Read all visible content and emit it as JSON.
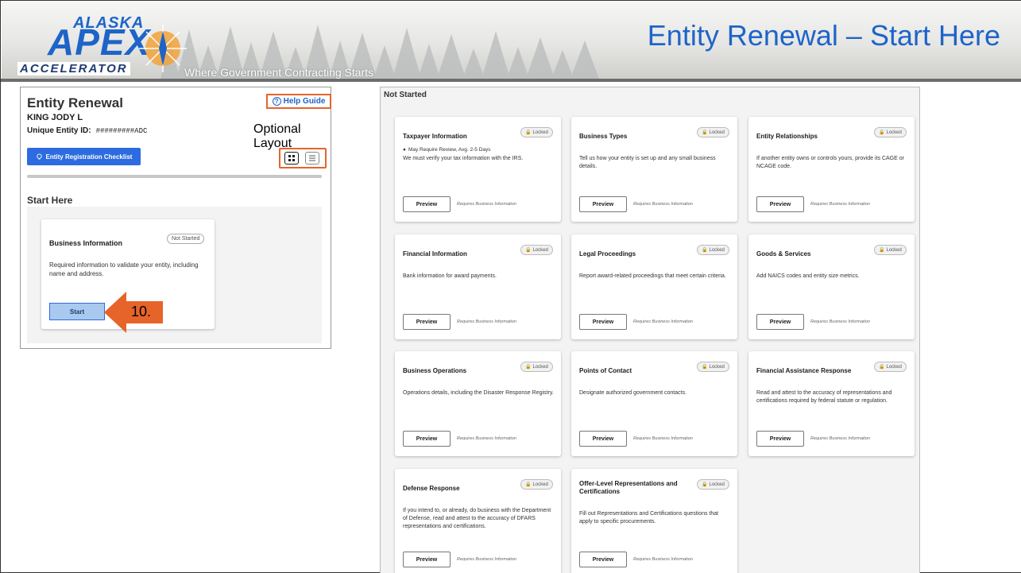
{
  "header": {
    "logo_top": "ALASKA",
    "logo_main": "APEX",
    "logo_bottom": "ACCELERATOR",
    "tagline": "Where Government Contracting Starts",
    "slide_title": "Entity Renewal – Start Here"
  },
  "left_panel": {
    "title": "Entity Renewal",
    "help_label": "Help Guide",
    "entity_name": "KING JODY L",
    "uei_label": "Unique Entity ID:",
    "uei_value": "#########ADC",
    "checklist_label": "Entity Registration Checklist",
    "optional_layout_label": "Optional Layout",
    "start_here_label": "Start Here",
    "business_card": {
      "title": "Business Information",
      "status": "Not Started",
      "description": "Required information to validate your entity, including name and address.",
      "start_label": "Start"
    },
    "callout_number": "10."
  },
  "right_panel": {
    "title": "Not Started",
    "locked_label": "Locked",
    "preview_label": "Preview",
    "requires_label": "Requires Business Information",
    "cards": [
      {
        "title": "Taxpayer Information",
        "note": "May Require Review, Avg. 2-5 Days",
        "description": "We must verify your tax information with the IRS."
      },
      {
        "title": "Business Types",
        "description": "Tell us how your entity is set up and any small business details."
      },
      {
        "title": "Entity Relationships",
        "description": "If another entity owns or controls yours, provide its CAGE or NCAGE code."
      },
      {
        "title": "Financial Information",
        "description": "Bank information for award payments."
      },
      {
        "title": "Legal Proceedings",
        "description": "Report award-related proceedings that meet certain criteria."
      },
      {
        "title": "Goods & Services",
        "description": "Add NAICS codes and entity size metrics."
      },
      {
        "title": "Business Operations",
        "description": "Operations details, including the Disaster Response Registry."
      },
      {
        "title": "Points of Contact",
        "description": "Designate authorized government contacts."
      },
      {
        "title": "Financial Assistance Response",
        "description": "Read and attest to the accuracy of representations and certifications required by federal statute or regulation."
      },
      {
        "title": "Defense Response",
        "description": "If you intend to, or already, do business with the Department of Defense, read and attest to the accuracy of DFARS representations and certifications."
      },
      {
        "title": "Offer-Level Representations and Certifications",
        "description": "Fill out Representations and Certifications questions that apply to specific procurements."
      }
    ]
  },
  "colors": {
    "brand_blue": "#1e64c8",
    "callout_orange": "#e6642a",
    "button_blue": "#2d6be0"
  }
}
